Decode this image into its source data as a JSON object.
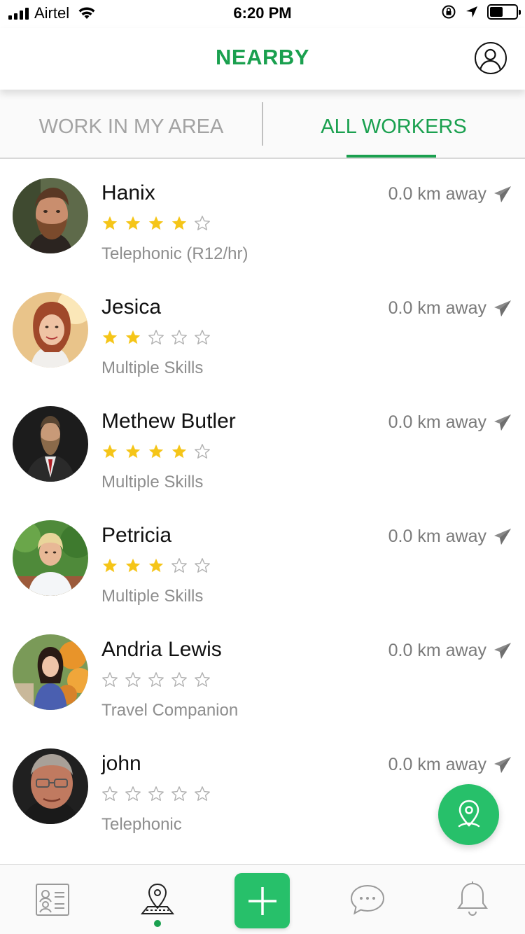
{
  "status_bar": {
    "carrier": "Airtel",
    "time": "6:20 PM"
  },
  "header": {
    "title": "NEARBY",
    "profile_icon": "user-circle-icon"
  },
  "tabs": [
    {
      "label": "WORK IN MY AREA",
      "active": false
    },
    {
      "label": "ALL WORKERS",
      "active": true
    }
  ],
  "colors": {
    "accent": "#1aa04f",
    "fab": "#27c06a",
    "star_filled": "#f5c518",
    "star_empty": "#b0b0b0"
  },
  "workers": [
    {
      "name": "Hanix",
      "rating": 4,
      "skill": "Telephonic (R12/hr)",
      "distance": "0.0 km away"
    },
    {
      "name": "Jesica",
      "rating": 2,
      "skill": "Multiple Skills",
      "distance": "0.0 km away"
    },
    {
      "name": "Methew Butler",
      "rating": 4,
      "skill": "Multiple Skills",
      "distance": "0.0 km away"
    },
    {
      "name": "Petricia",
      "rating": 3,
      "skill": "Multiple Skills",
      "distance": "0.0 km away"
    },
    {
      "name": "Andria Lewis",
      "rating": 0,
      "skill": "Travel Companion",
      "distance": "0.0 km away"
    },
    {
      "name": "john",
      "rating": 0,
      "skill": "Telephonic",
      "distance": "0.0 km away"
    }
  ],
  "fab": {
    "icon": "map-pin-icon"
  },
  "bottom_nav": [
    {
      "icon": "contacts-card-icon",
      "active": false
    },
    {
      "icon": "nearby-map-icon",
      "active": true
    },
    {
      "icon": "add-icon",
      "active": false
    },
    {
      "icon": "chat-icon",
      "active": false
    },
    {
      "icon": "bell-icon",
      "active": false
    }
  ]
}
